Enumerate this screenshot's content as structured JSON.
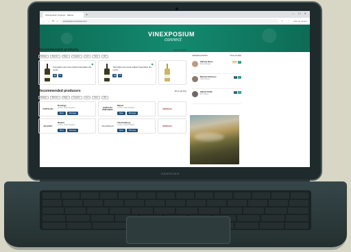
{
  "browser": {
    "tab_title": "Vinexposium Connect · Salons",
    "new_tab": "+",
    "url": "vinexposium-connect.com",
    "bookmarks": "Liste de lecture",
    "window_controls": "— ☐ ✕",
    "nav": {
      "back": "←",
      "forward": "→",
      "reload": "⟳",
      "home": "⌂"
    },
    "toolbar_icons": "☆ ⋮"
  },
  "banner": {
    "logo": "VINEXPOSIUM",
    "logo_sub": "connect"
  },
  "products": {
    "title": "Recommended products",
    "show_all": "Show all (656)",
    "filters": [
      "Rédéga",
      "Blancas",
      "Baga",
      "Fregante",
      "Geo",
      "More",
      "2RI"
    ],
    "items": [
      {
        "name": "Tulumattino del monte Isphiel Tulumattino del monte",
        "buttons": [
          "▤",
          "✉"
        ]
      },
      {
        "name": "Tulumattino del monte Isphiel Tulumattino del monte",
        "buttons": [
          "▤",
          "✉"
        ]
      }
    ]
  },
  "producers": {
    "title": "Recommended producers",
    "show_all": "Show all (54)",
    "filters": [
      "Rédéga",
      "Blancas",
      "Baga",
      "Fregante",
      "Geo",
      "More",
      "2RI"
    ],
    "items": [
      {
        "logo": "PORTALIDU",
        "name": "Domingo",
        "loc": "London, United Kingdom",
        "meet": "Meet",
        "message": "Message"
      },
      {
        "logo": "QUINTA DA ROMANEIRA",
        "name": "Mandi",
        "loc": "London, United Kingdom",
        "meet": "Meet",
        "message": "Message"
      },
      {
        "logo": "BODEGAS",
        "name": "",
        "loc": "",
        "meet": "",
        "message": ""
      },
      {
        "logo": "BALBARA",
        "name": "Beatriz",
        "loc": "London, United Kingdom",
        "meet": "Meet",
        "message": "Message"
      },
      {
        "logo": "Villa Stoffaiuolo",
        "name": "The Embassy",
        "loc": "London, United Kingdom",
        "meet": "Meet",
        "message": "Message"
      },
      {
        "logo": "BODEGAS",
        "name": "",
        "loc": "",
        "meet": "",
        "message": ""
      }
    ]
  },
  "attendees": {
    "title": "AMAZING EVENTS",
    "show_all": "Show all (366)",
    "items": [
      {
        "name": "Patricia Rivas",
        "role": "Sales Manager"
      },
      {
        "name": "Marcela Verbasco",
        "role": "Sales Director"
      },
      {
        "name": "Patrick Smith",
        "role": "Wine Buyer"
      }
    ],
    "tag": "Chat"
  },
  "device": {
    "brand": "SAMSUNG"
  }
}
